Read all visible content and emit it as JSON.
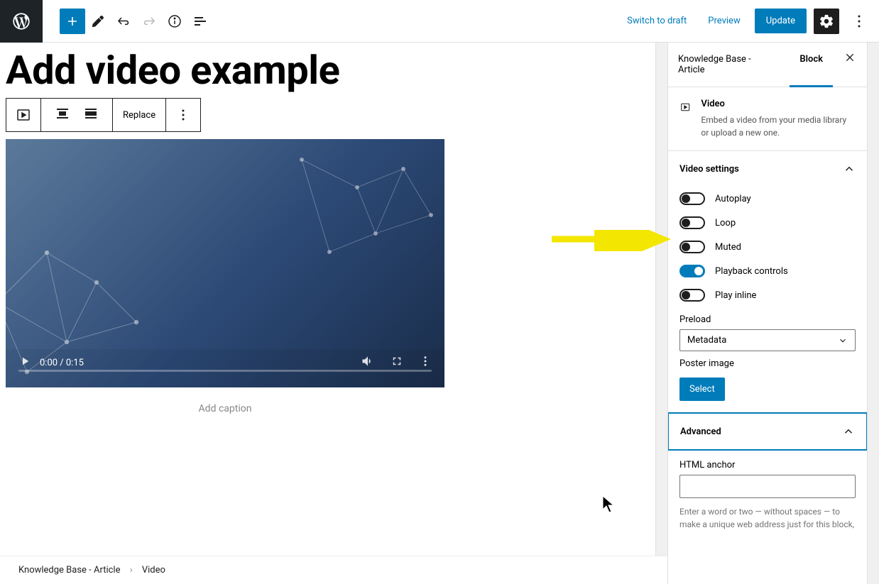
{
  "header": {
    "switch_draft": "Switch to draft",
    "preview": "Preview",
    "update": "Update"
  },
  "editor": {
    "title": "Add video example",
    "toolbar": {
      "replace": "Replace"
    },
    "video_time": "0:00 / 0:15",
    "caption_placeholder": "Add caption"
  },
  "sidebar": {
    "tab_document": "Knowledge Base - Article",
    "tab_block": "Block",
    "block_title": "Video",
    "block_description": "Embed a video from your media library or upload a new one.",
    "settings_panel": "Video settings",
    "toggles": {
      "autoplay": "Autoplay",
      "loop": "Loop",
      "muted": "Muted",
      "playback": "Playback controls",
      "play_inline": "Play inline"
    },
    "preload_label": "Preload",
    "preload_value": "Metadata",
    "poster_label": "Poster image",
    "select_btn": "Select",
    "advanced_panel": "Advanced",
    "anchor_label": "HTML anchor",
    "anchor_help": "Enter a word or two — without spaces — to make a unique web address just for this block,"
  },
  "breadcrumb": {
    "root": "Knowledge Base - Article",
    "current": "Video"
  }
}
